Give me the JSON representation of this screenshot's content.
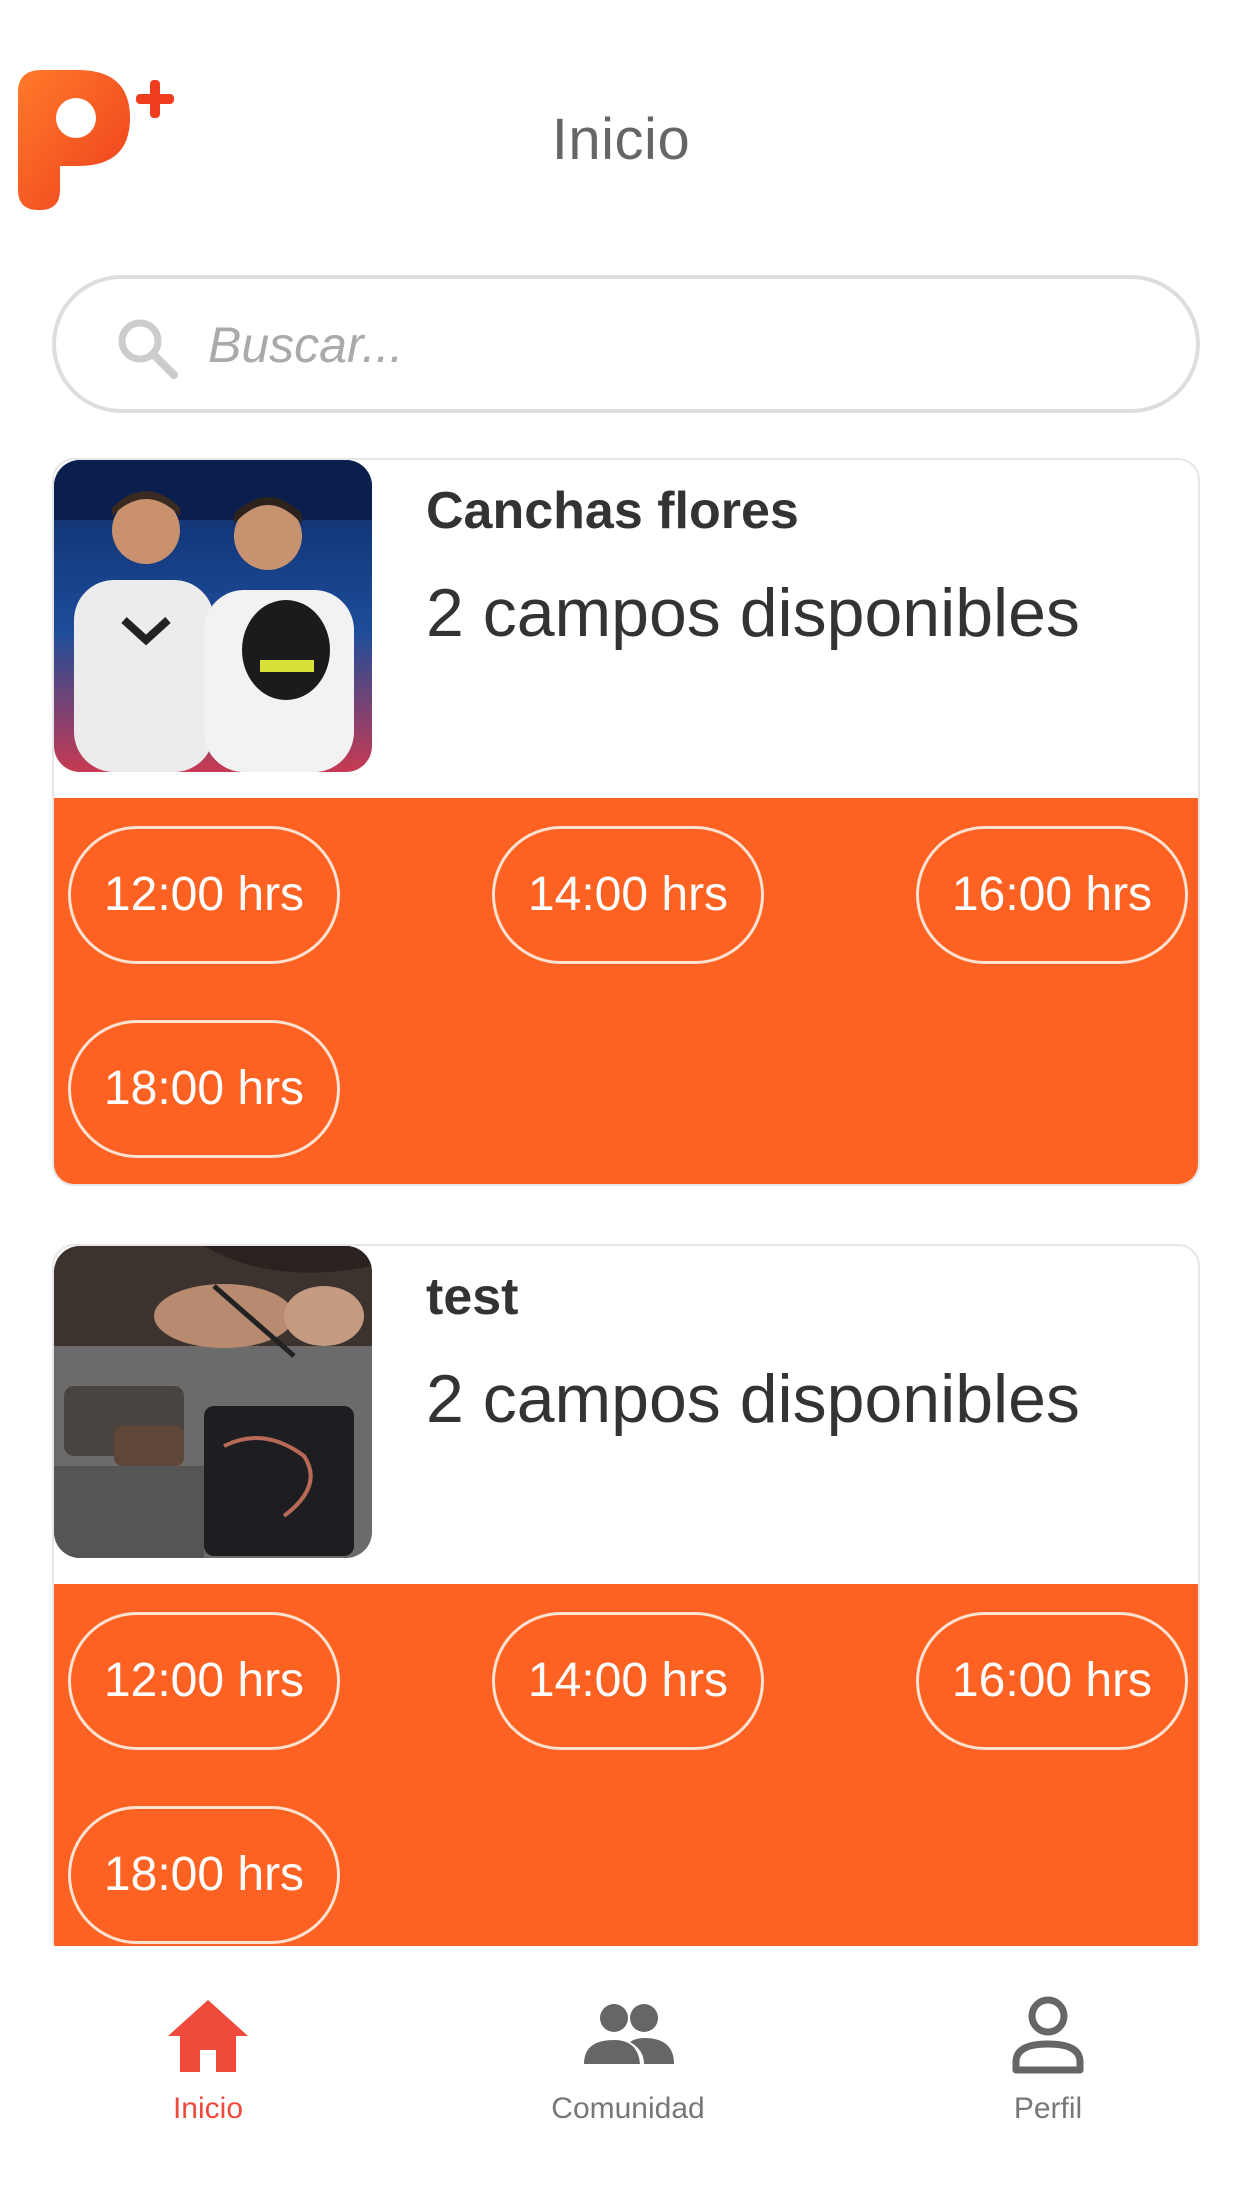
{
  "app": {
    "brand_color": "#fd6223",
    "accent_active": "#ef4a3c"
  },
  "header": {
    "title": "Inicio",
    "logo_icon": "padel-plus-logo"
  },
  "search": {
    "placeholder": "Buscar...",
    "value": "",
    "icon": "search-icon"
  },
  "venues": [
    {
      "name": "Canchas flores",
      "availability": "2 campos disponibles",
      "image_icon": "players-photo",
      "slots": [
        "12:00 hrs",
        "14:00 hrs",
        "16:00 hrs",
        "18:00 hrs"
      ]
    },
    {
      "name": "test",
      "availability": "2 campos disponibles",
      "image_icon": "craft-tools-photo",
      "slots": [
        "12:00 hrs",
        "14:00 hrs",
        "16:00 hrs",
        "18:00 hrs"
      ]
    }
  ],
  "bottom_nav": {
    "items": [
      {
        "label": "Inicio",
        "icon": "home-icon",
        "active": true
      },
      {
        "label": "Comunidad",
        "icon": "people-icon",
        "active": false
      },
      {
        "label": "Perfil",
        "icon": "person-icon",
        "active": false
      }
    ]
  }
}
